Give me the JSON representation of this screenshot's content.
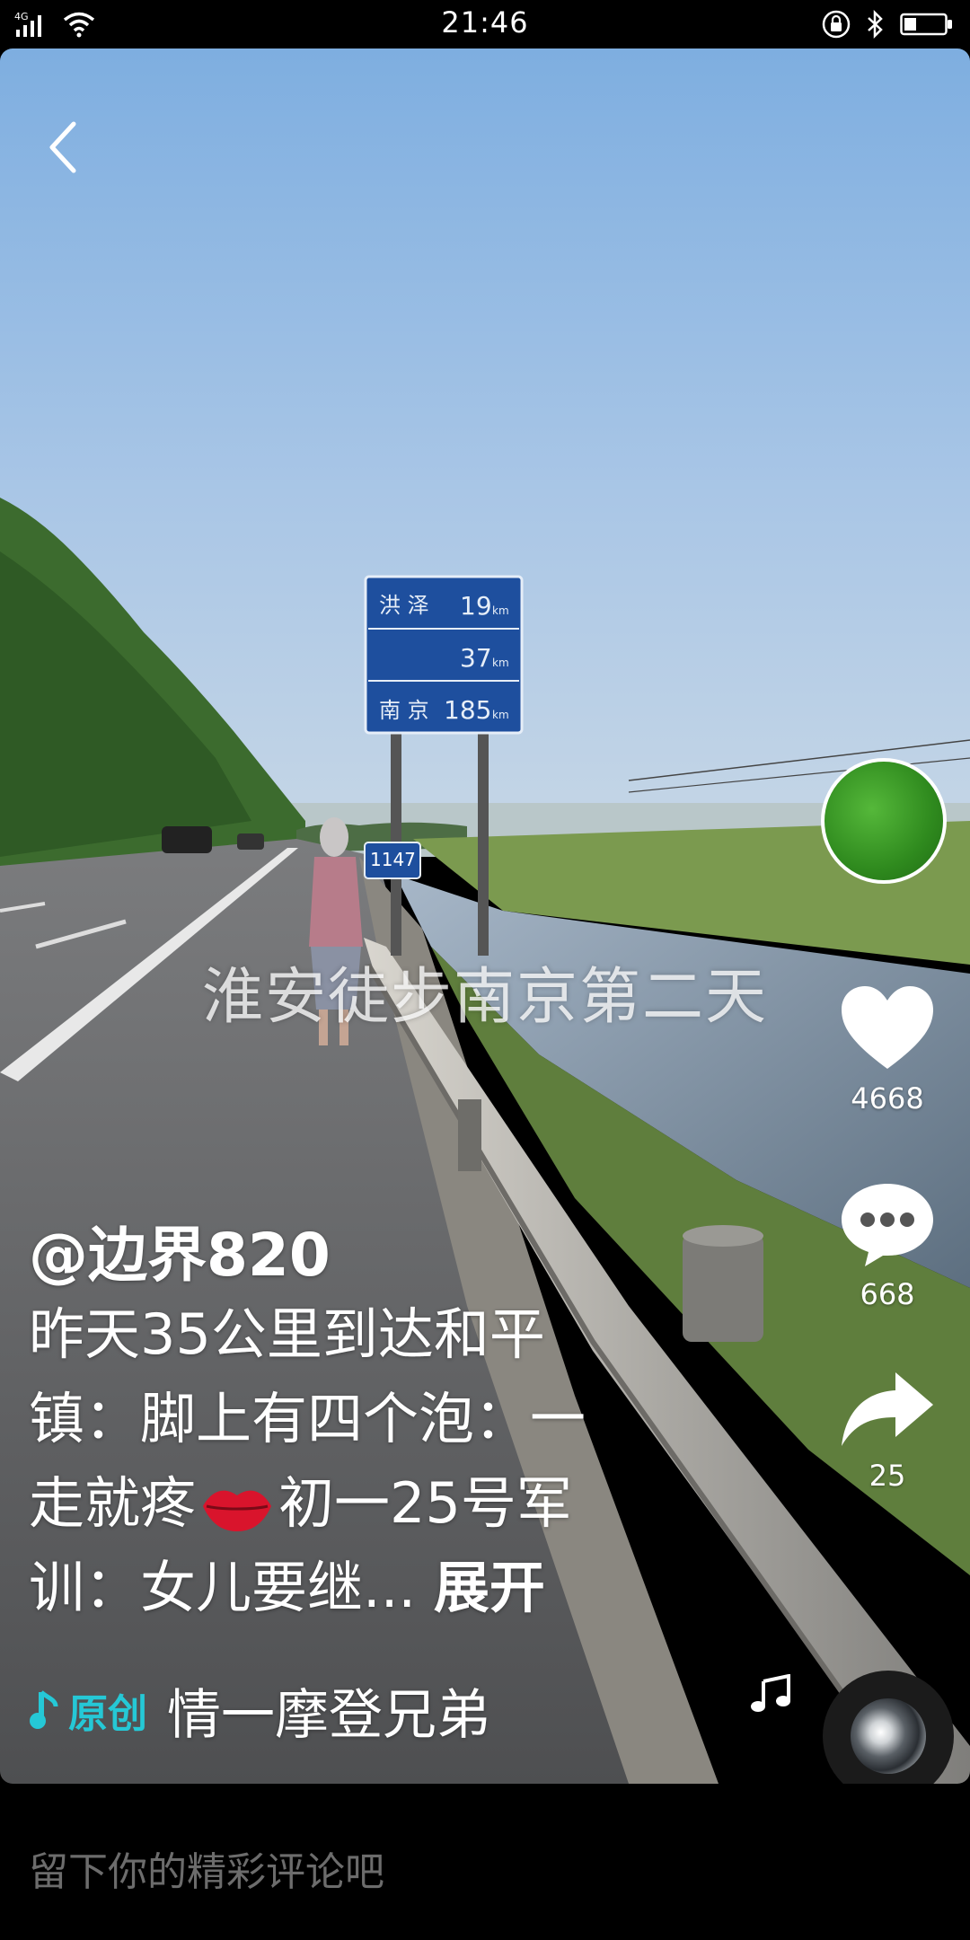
{
  "status_bar": {
    "network": "4G",
    "time": "21:46"
  },
  "video": {
    "overlay_title": "淮安徒步南京第二天",
    "sign": {
      "rows": [
        {
          "place": "洪 泽",
          "distance": "19",
          "unit": "km"
        },
        {
          "place": "",
          "distance": "37",
          "unit": "km"
        },
        {
          "place": "南 京",
          "distance": "185",
          "unit": "km"
        }
      ],
      "road_number": "1147"
    }
  },
  "actions": {
    "likes": "4668",
    "comments": "668",
    "shares": "25"
  },
  "post": {
    "author": "@边界820",
    "caption_lines": [
      "昨天35公里到达和平",
      "镇：脚上有四个泡：一",
      "走就疼",
      "初一25号军",
      "训：女儿要继... "
    ],
    "expand_label": "展开",
    "music_tag": "原创",
    "music_title": "情一摩登兄弟"
  },
  "comment_input": {
    "placeholder": "留下你的精彩评论吧"
  },
  "colors": {
    "accent_cyan": "#25c8d6",
    "sky_top": "#7eaee0",
    "sign_blue": "#1e4f9e"
  }
}
